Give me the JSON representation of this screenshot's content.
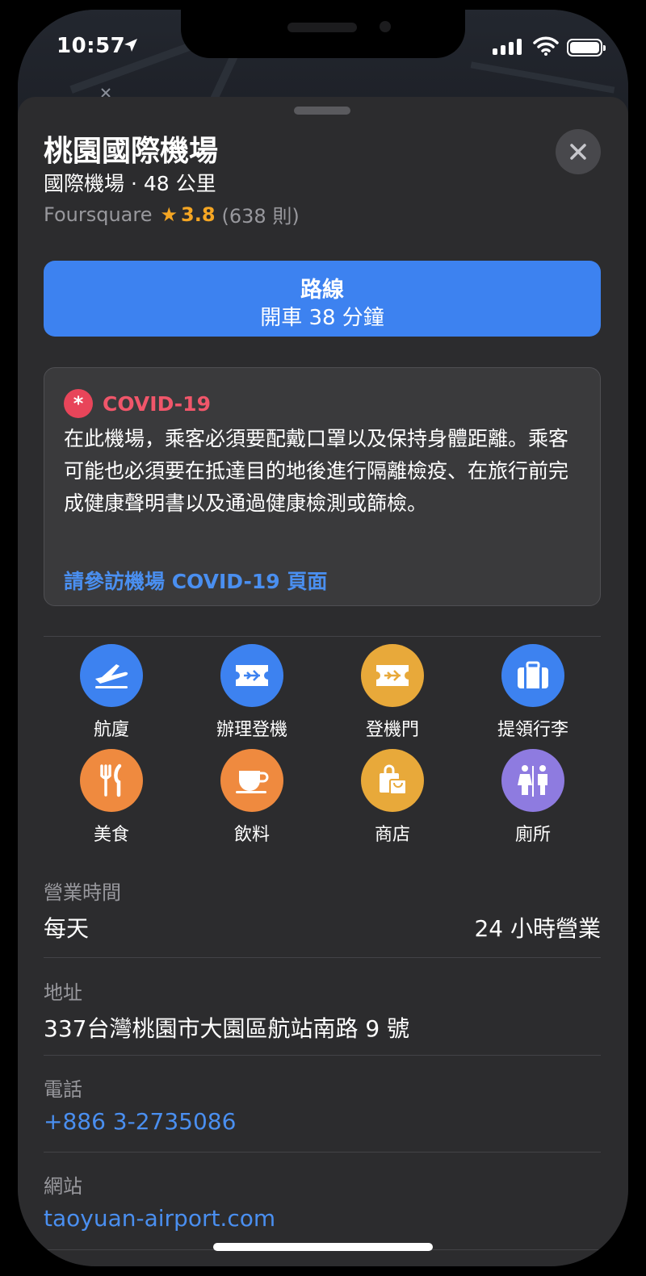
{
  "status_bar": {
    "time": "10:57"
  },
  "place": {
    "name": "桃園國際機場",
    "subtitle": "國際機場 · 48 公里",
    "rating_source": "Foursquare",
    "rating_score": "3.8",
    "rating_count": "(638 則)"
  },
  "route": {
    "label": "路線",
    "detail": "開車 38 分鐘"
  },
  "covid": {
    "title": "COVID-19",
    "body": "在此機場，乘客必須要配戴口罩以及保持身體距離。乘客可能也必須要在抵達目的地後進行隔離檢疫、在旅行前完成健康聲明書以及通過健康檢測或篩檢。",
    "link": "請參訪機場 COVID-19 頁面"
  },
  "categories": [
    {
      "label": "航廈",
      "icon": "plane-icon",
      "color": "#3d82f0"
    },
    {
      "label": "辦理登機",
      "icon": "ticket-icon",
      "color": "#3d82f0"
    },
    {
      "label": "登機門",
      "icon": "ticket-icon",
      "color": "#e8a93a"
    },
    {
      "label": "提領行李",
      "icon": "suitcase-icon",
      "color": "#3d82f0"
    },
    {
      "label": "美食",
      "icon": "fork-knife-icon",
      "color": "#ef8a3f"
    },
    {
      "label": "飲料",
      "icon": "cup-icon",
      "color": "#ef8a3f"
    },
    {
      "label": "商店",
      "icon": "shopping-bag-icon",
      "color": "#e8a93a"
    },
    {
      "label": "廁所",
      "icon": "restroom-icon",
      "color": "#8e7be0"
    }
  ],
  "hours": {
    "label": "營業時間",
    "day": "每天",
    "time": "24 小時營業"
  },
  "address": {
    "label": "地址",
    "value": "337台灣桃園市大園區航站南路 9 號"
  },
  "phone": {
    "label": "電話",
    "value": "+886 3-2735086"
  },
  "website": {
    "label": "網站",
    "value": "taoyuan-airport.com"
  }
}
